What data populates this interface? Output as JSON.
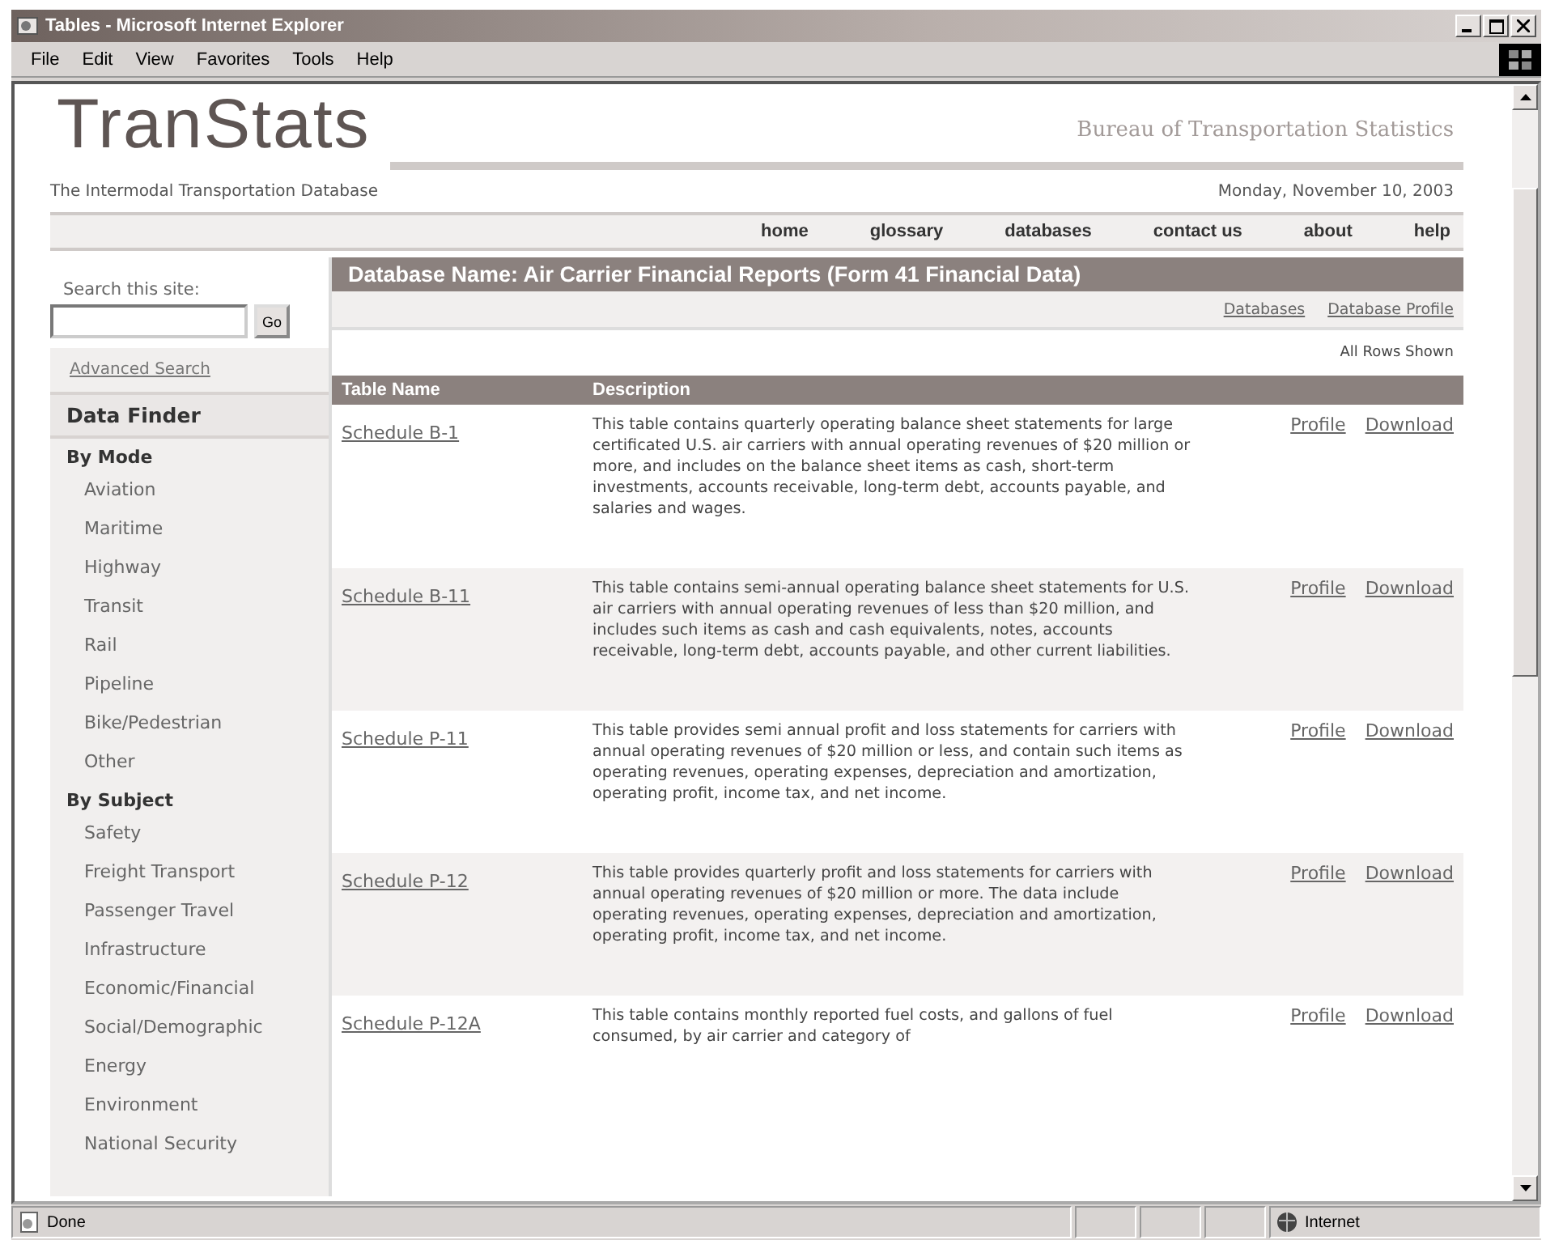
{
  "window": {
    "title": "Tables - Microsoft Internet Explorer"
  },
  "menu": [
    "File",
    "Edit",
    "View",
    "Favorites",
    "Tools",
    "Help"
  ],
  "header": {
    "logo": "TranStats",
    "agency": "Bureau of Transportation Statistics",
    "tagline": "The Intermodal Transportation Database",
    "date": "Monday, November 10, 2003"
  },
  "nav": [
    "home",
    "glossary",
    "databases",
    "contact us",
    "about",
    "help"
  ],
  "search": {
    "label": "Search this site:",
    "button": "Go",
    "advanced": "Advanced Search"
  },
  "data_finder": {
    "title": "Data Finder",
    "groups": [
      {
        "heading": "By Mode",
        "items": [
          "Aviation",
          "Maritime",
          "Highway",
          "Transit",
          "Rail",
          "Pipeline",
          "Bike/Pedestrian",
          "Other"
        ]
      },
      {
        "heading": "By Subject",
        "items": [
          "Safety",
          "Freight Transport",
          "Passenger Travel",
          "Infrastructure",
          "Economic/Financial",
          "Social/Demographic",
          "Energy",
          "Environment",
          "National Security"
        ]
      }
    ]
  },
  "database": {
    "title": "Database Name: Air Carrier Financial Reports (Form 41 Financial Data)",
    "links": [
      "Databases",
      "Database Profile"
    ],
    "rows_note": "All Rows Shown"
  },
  "table": {
    "columns": [
      "Table Name",
      "Description"
    ],
    "rows": [
      {
        "name": "Schedule B-1",
        "description": "This table contains quarterly operating balance sheet statements for large certificated U.S. air carriers with annual operating revenues of $20 million or more, and includes on the balance sheet items as cash, short-term investments, accounts receivable, long-term debt, accounts payable, and salaries and wages.",
        "links": [
          "Profile",
          "Download"
        ]
      },
      {
        "name": "Schedule B-11",
        "description": "This table contains semi-annual operating balance sheet statements for U.S. air carriers with annual operating revenues of less than $20 million, and includes such items as cash and cash equivalents, notes, accounts receivable, long-term debt, accounts payable, and other current liabilities.",
        "links": [
          "Profile",
          "Download"
        ]
      },
      {
        "name": "Schedule P-11",
        "description": "This table provides semi annual profit and loss statements for carriers with annual operating revenues of $20 million or less, and contain such items as operating revenues, operating expenses, depreciation and amortization, operating profit, income tax, and net income.",
        "links": [
          "Profile",
          "Download"
        ]
      },
      {
        "name": "Schedule P-12",
        "description": "This table provides quarterly profit and loss statements for carriers with annual operating revenues of $20 million or more. The data include operating revenues, operating expenses, depreciation and amortization, operating profit, income tax, and net income.",
        "links": [
          "Profile",
          "Download"
        ]
      },
      {
        "name": "Schedule P-12A",
        "description": "This table contains monthly reported fuel costs, and gallons of fuel consumed, by air carrier and category of",
        "links": [
          "Profile",
          "Download"
        ]
      }
    ]
  },
  "status_bar": {
    "text": "Done",
    "zone": "Internet"
  }
}
